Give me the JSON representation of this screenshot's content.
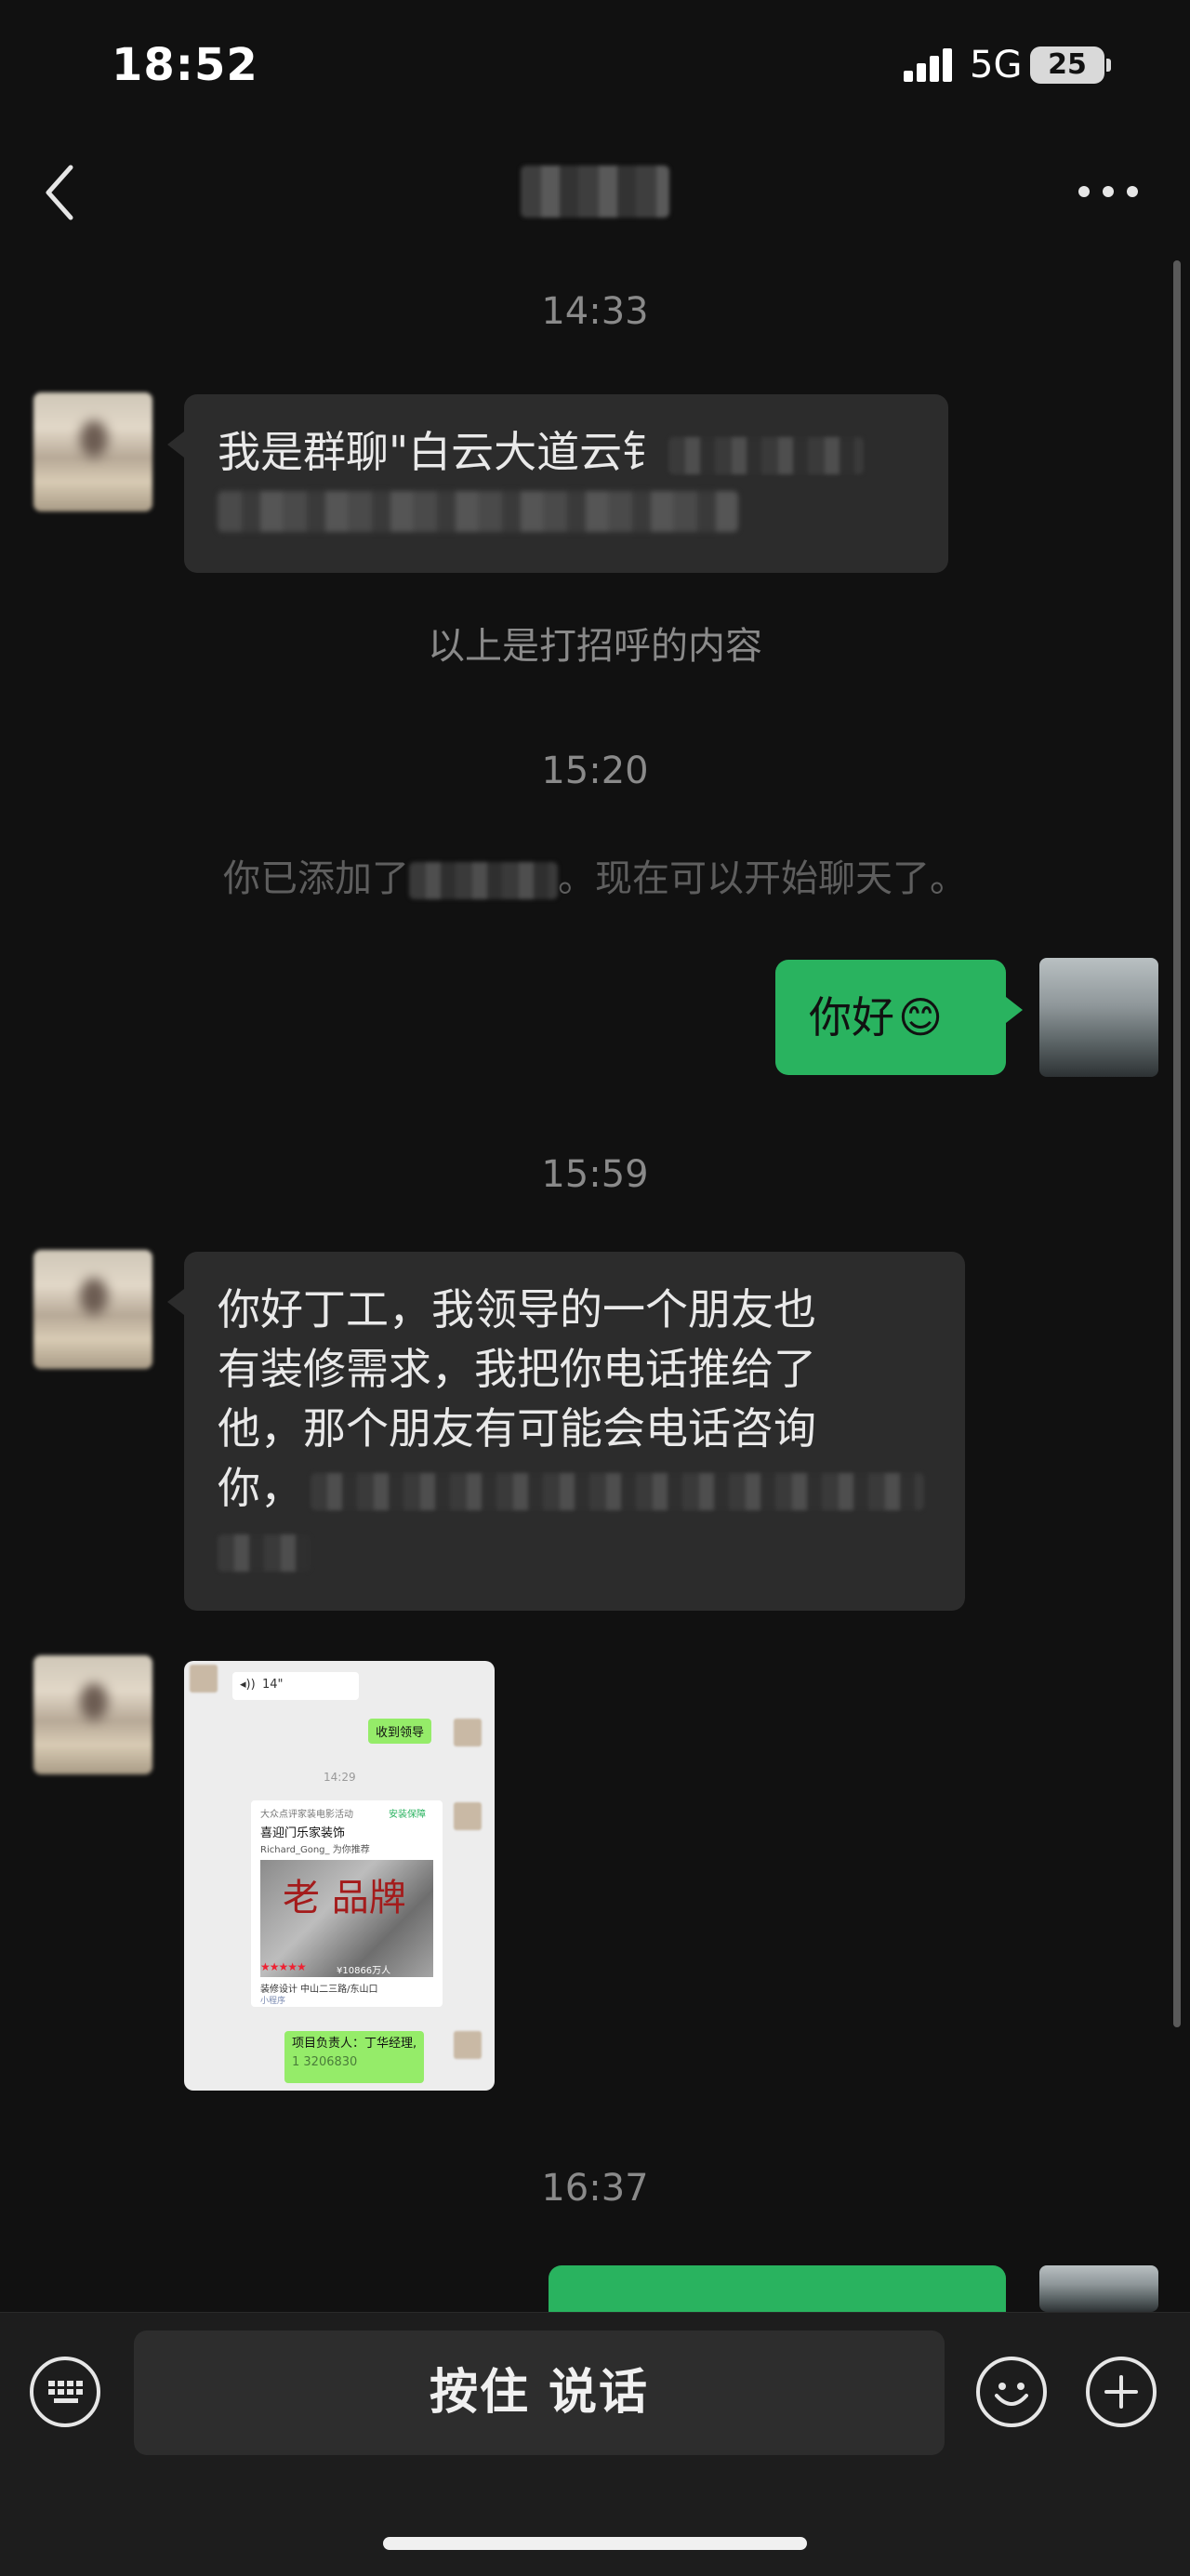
{
  "status_bar": {
    "time": "18:52",
    "network": "5G",
    "battery": "25"
  },
  "nav": {
    "title": ""
  },
  "messages": {
    "ts1": "14:33",
    "greeting_text": "我是群聊\"白云大道云钅",
    "greeting_footer": "以上是打招呼的内容",
    "ts2": "15:20",
    "added_prefix": "你已添加了",
    "added_suffix": "。现在可以开始聊天了。",
    "hello_text": "你好",
    "hello_emoji": "😊",
    "ts3": "15:59",
    "long_lines": [
      "你好丁工，我领导的一个朋友也",
      "有装修需求，我把你电话推给了",
      "他，那个朋友有可能会电话咨询",
      "你，"
    ],
    "ts4": "16:37"
  },
  "image_message": {
    "voice_duration": "14\"",
    "green1": "收到领导",
    "time": "14:29",
    "app_name": "大众点评家装电影活动",
    "verified": "安装保障",
    "shop_name": "喜迎门乐家装饰",
    "recommender": "Richard_Gong_ 为你推荐",
    "brand_text": "老 品牌",
    "rating_text": "¥10866万人",
    "meta_line": "装修设计   中山二三路/东山口",
    "mini_program": "小程序",
    "green2": "项目负责人：丁华经理,",
    "green2_phone": "1   3206830"
  },
  "input_bar": {
    "hold_to_talk": "按住 说话"
  },
  "icons": [
    "chevron-left-icon",
    "more-icon",
    "keyboard-icon",
    "emoji-icon",
    "plus-icon"
  ],
  "colors": {
    "background": "#111111",
    "bubble_in": "#2c2c2c",
    "bubble_out": "#29b35f"
  }
}
